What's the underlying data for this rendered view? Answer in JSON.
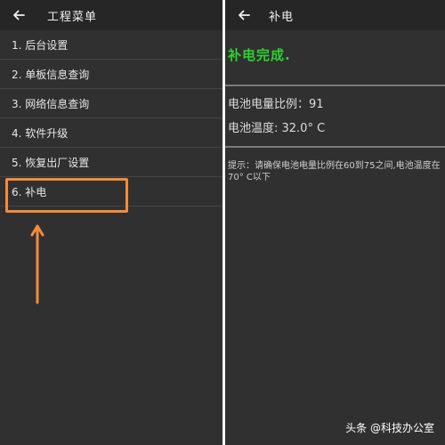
{
  "left_panel": {
    "title": "工程菜单",
    "menu_items": [
      {
        "label": "1. 后台设置"
      },
      {
        "label": "2. 单板信息查询"
      },
      {
        "label": "3. 网络信息查询"
      },
      {
        "label": "4. 软件升级"
      },
      {
        "label": "5. 恢复出厂设置"
      },
      {
        "label": "6. 补电"
      }
    ],
    "annotation_color": "#f28c3a"
  },
  "right_panel": {
    "title": "补电",
    "status": "补电完成.",
    "battery_ratio": "电池电量比例：91",
    "battery_temp": "电池温度: 32.0° C",
    "hint": "提示：请确保电池电量比例在60到75之间,电池温度在70° C以下"
  },
  "watermark": "头条 @科技办公室",
  "icons": {
    "back": "back-arrow-icon"
  },
  "colors": {
    "background": "#303030",
    "appbar": "#262626",
    "success": "#2ed12e",
    "highlight": "#f28c3a"
  }
}
